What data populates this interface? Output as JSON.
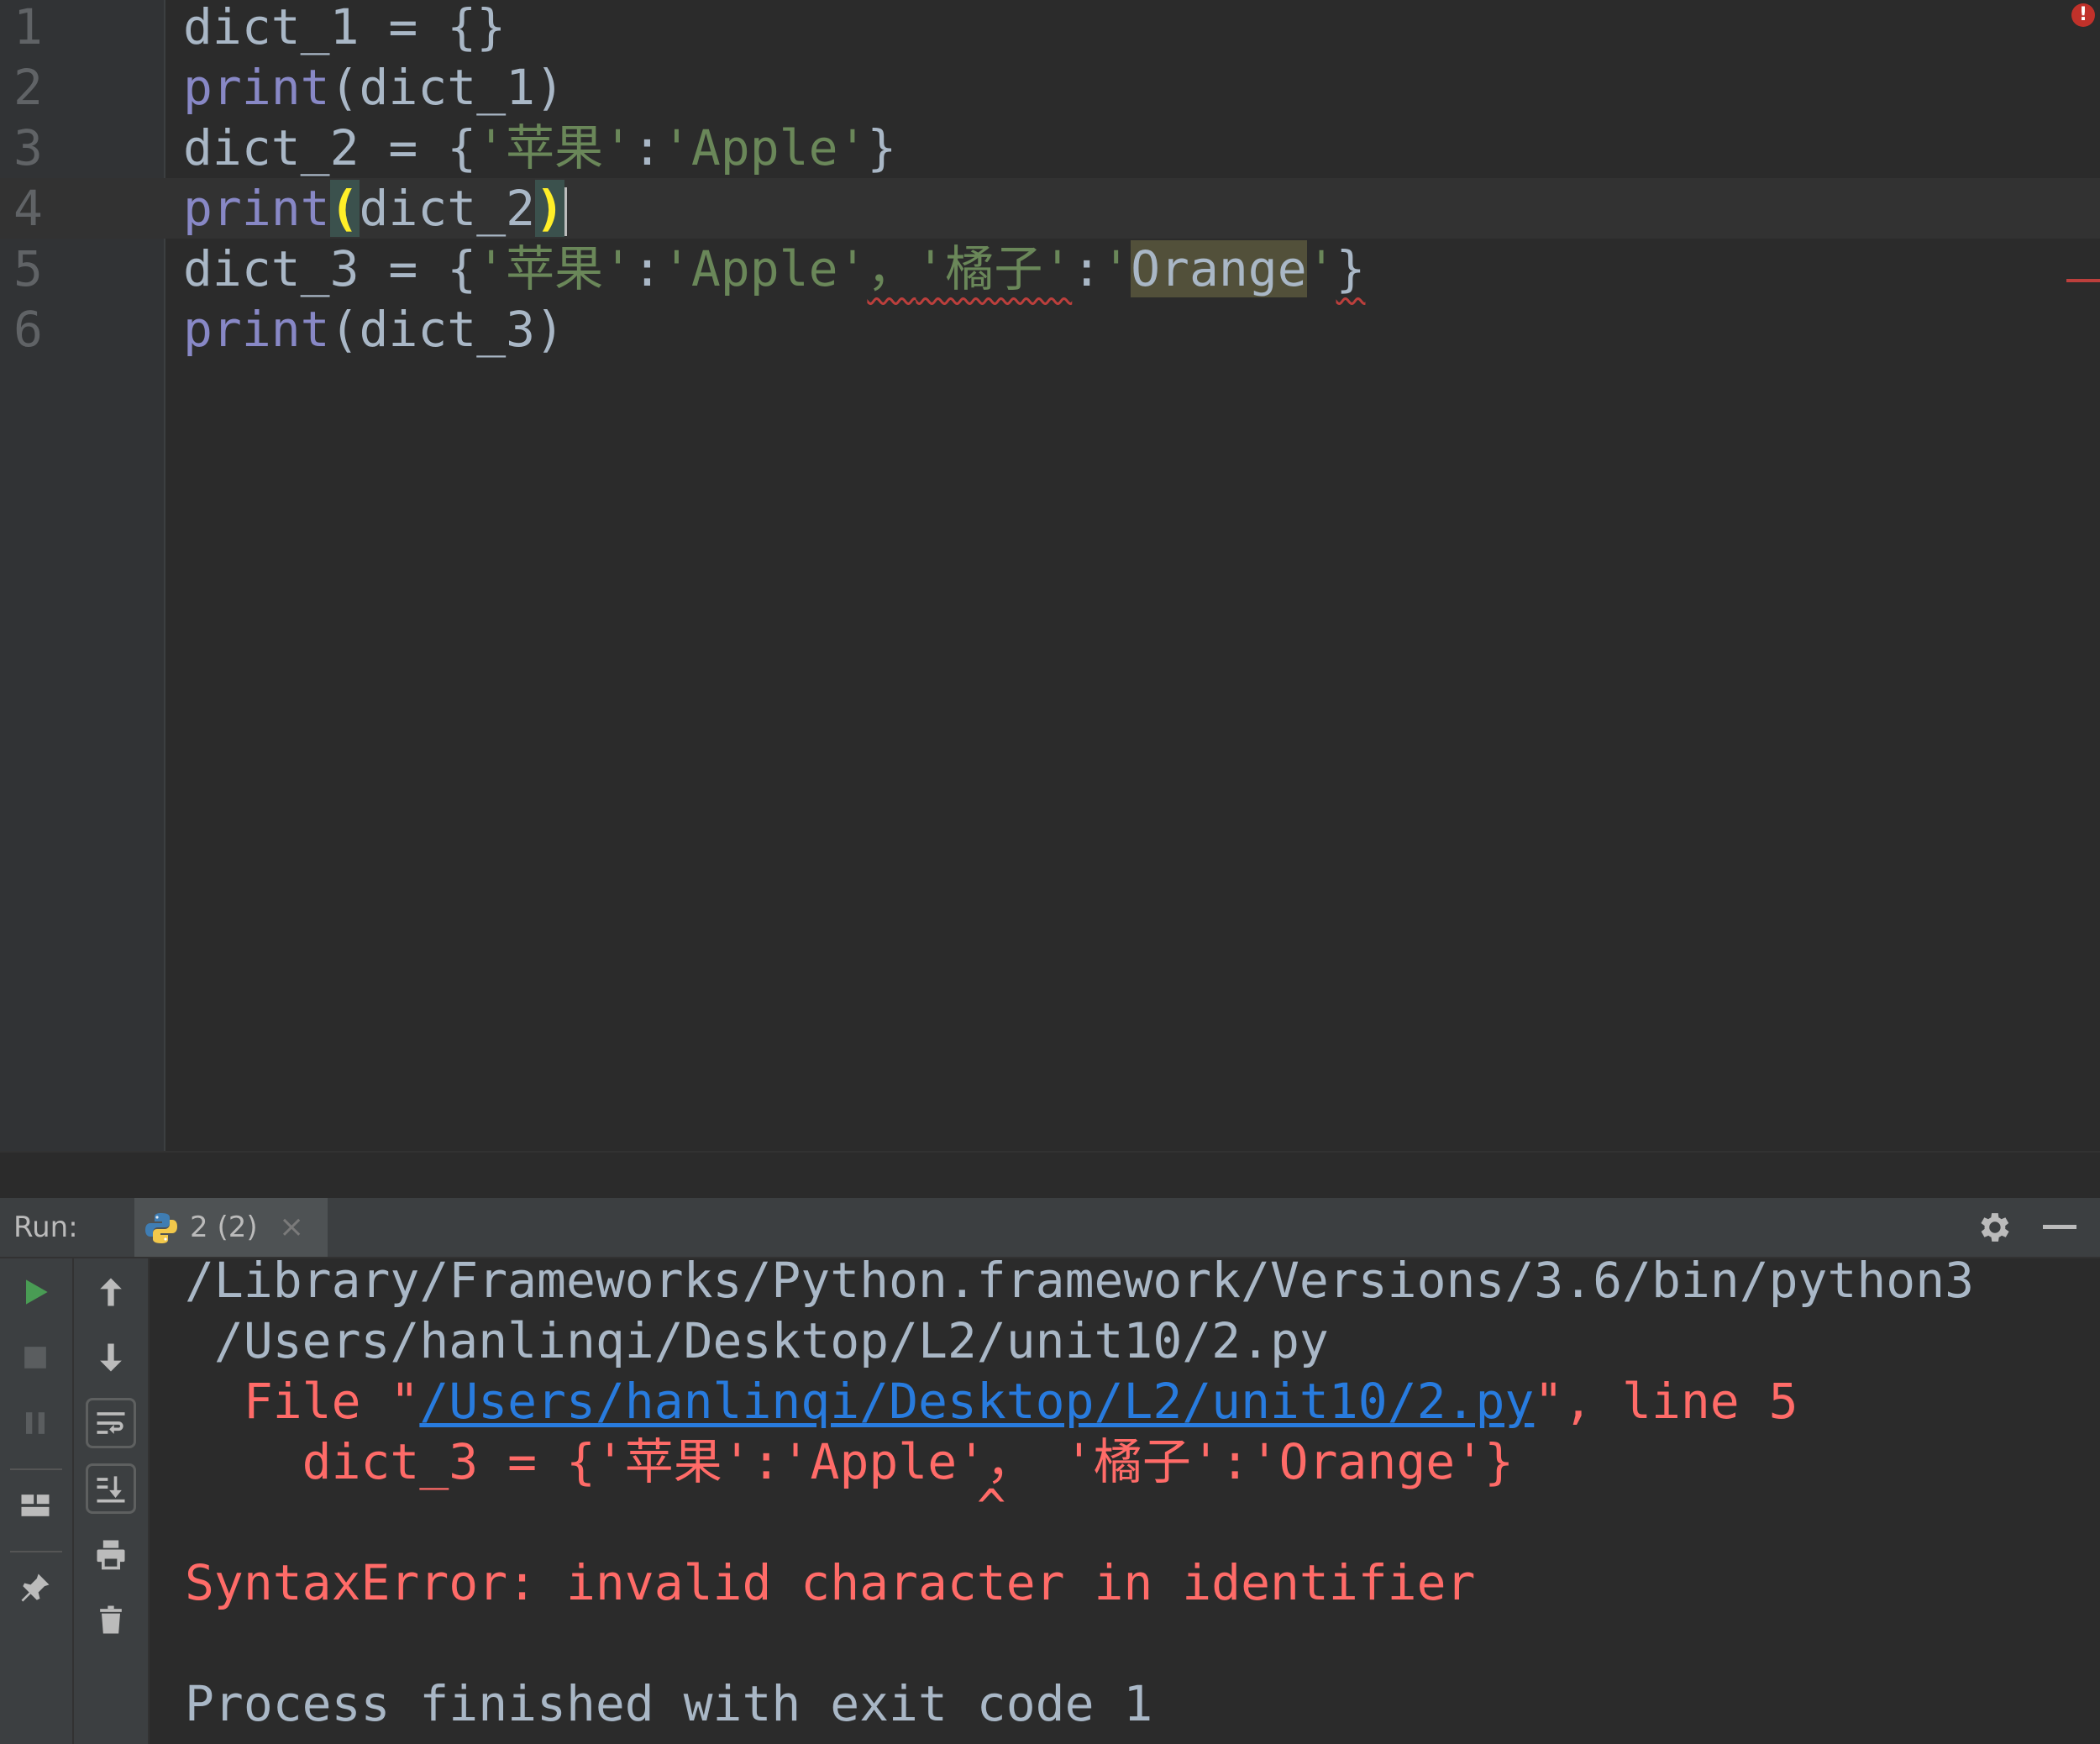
{
  "editor": {
    "line_numbers": [
      "1",
      "2",
      "3",
      "4",
      "5",
      "6"
    ],
    "lines": [
      {
        "pre": "dict_1 = {}"
      },
      {
        "kw": "print",
        "rest": "(dict_1)"
      },
      {
        "a": "dict_2 = {",
        "s1": "'苹果'",
        "c": ":",
        "s2": "'Apple'",
        "e": "}"
      },
      {
        "kw": "print",
        "open": "(",
        "mid": "dict_2",
        "close": ")"
      },
      {
        "a": "dict_3 = {",
        "s1": "'苹果'",
        "c1": ":",
        "s2": "'Apple'",
        "bad1": "，",
        "s3": "'橘子'",
        "c2": ":",
        "q1": "'",
        "word": "Orange",
        "q2": "'",
        "bad2": "}"
      },
      {
        "kw": "print",
        "rest": "(dict_3)"
      }
    ],
    "error_badge": "!"
  },
  "run_panel": {
    "label": "Run:",
    "tab_name": "2 (2)",
    "tab_close": "×",
    "output": {
      "line1": "/Library/Frameworks/Python.framework/Versions/3.6/bin/python3",
      "line2": " /Users/hanlinqi/Desktop/L2/unit10/2.py",
      "file_prefix": "  File \"",
      "file_link": "/Users/hanlinqi/Desktop/L2/unit10/2.py",
      "file_suffix": "\", line 5",
      "code_line": "    dict_3 = {'苹果':'Apple'， '橘子':'Orange'}",
      "caret_line": "                           ^",
      "error_line": "SyntaxError: invalid character in identifier",
      "exit_line": "Process finished with exit code 1"
    }
  },
  "colors": {
    "background": "#2b2b2b",
    "keyword": "#8888c6",
    "string": "#6a8759",
    "error_text": "#ff6b68",
    "link": "#287bde"
  }
}
